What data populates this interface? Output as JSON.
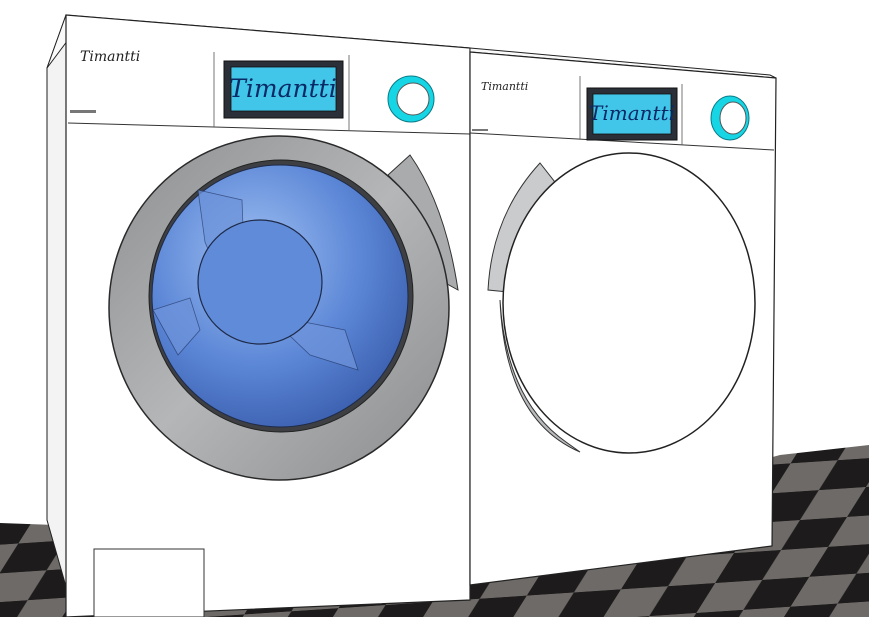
{
  "washer": {
    "brand_label": "Timantti",
    "display_text": "Timantti"
  },
  "dryer": {
    "brand_label": "Timantti",
    "display_text": "Timantti"
  },
  "colors": {
    "display_bg": "#41c6ea",
    "knob_ring": "#16d6e6",
    "glass": "#5b86d6",
    "door_ring": "#a9abad",
    "floor_dark": "#1d1b1b",
    "floor_light": "#6e6a68"
  }
}
